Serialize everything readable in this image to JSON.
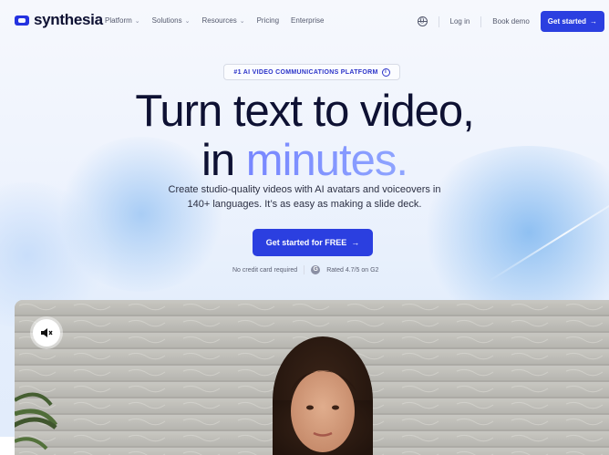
{
  "brand": {
    "name": "synthesia",
    "accent": "#2b3fe0"
  },
  "nav": {
    "items": [
      {
        "label": "Platform",
        "has_dropdown": true
      },
      {
        "label": "Solutions",
        "has_dropdown": true
      },
      {
        "label": "Resources",
        "has_dropdown": true
      },
      {
        "label": "Pricing",
        "has_dropdown": false
      },
      {
        "label": "Enterprise",
        "has_dropdown": false
      }
    ],
    "chevron": "⌄",
    "language_icon": "globe-icon",
    "login": "Log in",
    "book_demo": "Book demo",
    "get_started": "Get started",
    "arrow": "→"
  },
  "hero": {
    "badge": "#1 AI VIDEO COMMUNICATIONS PLATFORM",
    "badge_icon": "info-icon",
    "title_line1": "Turn text to video,",
    "title_line2_plain": "in",
    "title_line2_highlight": "minutes.",
    "subtitle_line1": "Create studio-quality videos with AI avatars and voiceovers in",
    "subtitle_line2": "140+ languages. It’s as easy as making a slide deck.",
    "cta": "Get started for FREE",
    "cta_arrow": "→",
    "note": "No credit card required",
    "rating_logo": "G",
    "rating": "Rated 4.7/5 on G2"
  },
  "video": {
    "mute_icon": "speaker-muted-icon"
  }
}
